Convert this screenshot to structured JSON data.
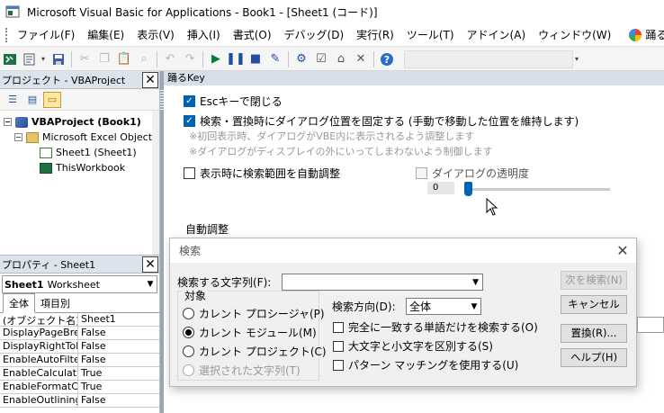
{
  "window": {
    "title": "Microsoft Visual Basic for Applications - Book1 - [Sheet1 (コード)]"
  },
  "menu": {
    "items": [
      "ファイル(F)",
      "編集(E)",
      "表示(V)",
      "挿入(I)",
      "書式(O)",
      "デバッグ(D)",
      "実行(R)",
      "ツール(T)",
      "アドイン(A)",
      "ウィンドウ(W)"
    ],
    "ext_button_1": "踊る検索",
    "ext_button_2_icon": "ab"
  },
  "project_panel": {
    "title": "プロジェクト - VBAProject",
    "tree": [
      {
        "label": "VBAProject (Book1)",
        "level": 0
      },
      {
        "label": "Microsoft Excel Object",
        "level": 1
      },
      {
        "label": "Sheet1 (Sheet1)",
        "level": 2
      },
      {
        "label": "ThisWorkbook",
        "level": 2
      }
    ]
  },
  "properties_panel": {
    "title": "プロパティ - Sheet1",
    "object_name": "Sheet1",
    "object_type": "Worksheet",
    "tabs": [
      "全体",
      "項目別"
    ],
    "rows": [
      [
        "(オブジェクト名)",
        "Sheet1"
      ],
      [
        "DisplayPageBrea",
        "False"
      ],
      [
        "DisplayRightToLe",
        "False"
      ],
      [
        "EnableAutoFilter",
        "False"
      ],
      [
        "EnableCalculatio",
        "True"
      ],
      [
        "EnableFormatCon",
        "True"
      ],
      [
        "EnableOutlining",
        "False"
      ]
    ]
  },
  "settings": {
    "header": "踊るKey",
    "esc_close": "Escキーで閉じる",
    "fix_position": "検索・置換時にダイアログ位置を固定する (手動で移動した位置を維持します)",
    "note1": "※初回表示時、ダイアログがVBE内に表示されるよう調整します",
    "note2": "※ダイアログがディスプレイの外にいってしまわないよう制御します",
    "auto_range": "表示時に検索範囲を自動調整",
    "transparency": "ダイアログの透明度",
    "transparency_value": "0",
    "auto_adjust": "自動調整"
  },
  "dialog": {
    "title": "検索",
    "find_label": "検索する文字列(F):",
    "find_value": "",
    "target_label": "対象",
    "radios": [
      "カレント プロシージャ(P)",
      "カレント モジュール(M)",
      "カレント プロジェクト(C)",
      "選択された文字列(T)"
    ],
    "direction_label": "検索方向(D):",
    "direction_value": "全体",
    "checks": [
      "完全に一致する単語だけを検索する(O)",
      "大文字と小文字を区別する(S)",
      "パターン マッチングを使用する(U)"
    ],
    "buttons": {
      "find_next": "次を検索(N)",
      "cancel": "キャンセル",
      "replace": "置換(R)...",
      "help": "ヘルプ(H)"
    }
  }
}
